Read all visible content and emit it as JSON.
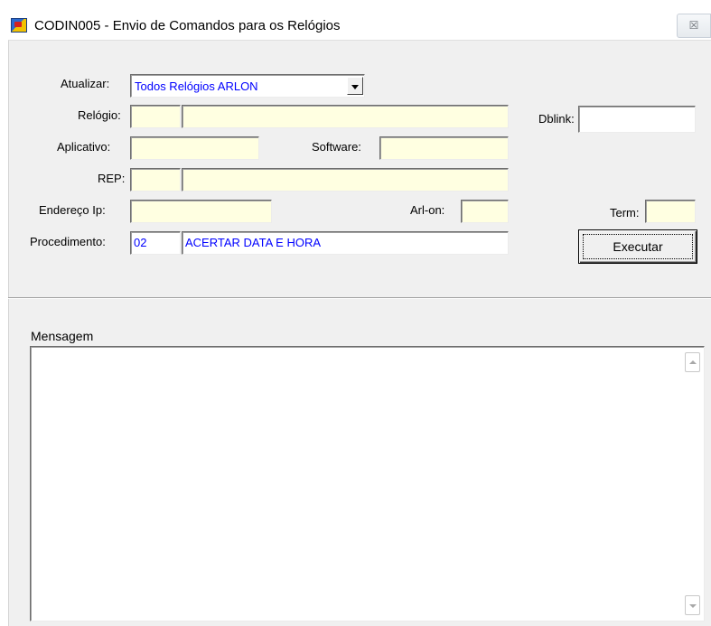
{
  "window": {
    "title": "CODIN005 - Envio de Comandos para os Relógios",
    "icon": "app-window-icon",
    "close_glyph": "☒"
  },
  "form": {
    "atualizar_label": "Atualizar:",
    "atualizar_value": "Todos Relógios ARLON",
    "relogio_label": "Relógio:",
    "relogio_code": "",
    "relogio_desc": "",
    "dblink_label": "Dblink:",
    "dblink_value": "",
    "aplicativo_label": "Aplicativo:",
    "aplicativo_value": "",
    "software_label": "Software:",
    "software_value": "",
    "rep_label": "REP:",
    "rep_code": "",
    "rep_desc": "",
    "endereco_label": "Endereço Ip:",
    "endereco_value": "",
    "arlon_label": "Arl-on:",
    "arlon_value": "",
    "term_label": "Term:",
    "term_value": "",
    "procedimento_label": "Procedimento:",
    "procedimento_code": "02",
    "procedimento_desc": "ACERTAR DATA E HORA",
    "executar_label": "Executar"
  },
  "message": {
    "label": "Mensagem",
    "text": ""
  },
  "colors": {
    "field_bg": "#ffffe1",
    "value_text": "#0000ff",
    "form_bg": "#f0f0f0"
  }
}
